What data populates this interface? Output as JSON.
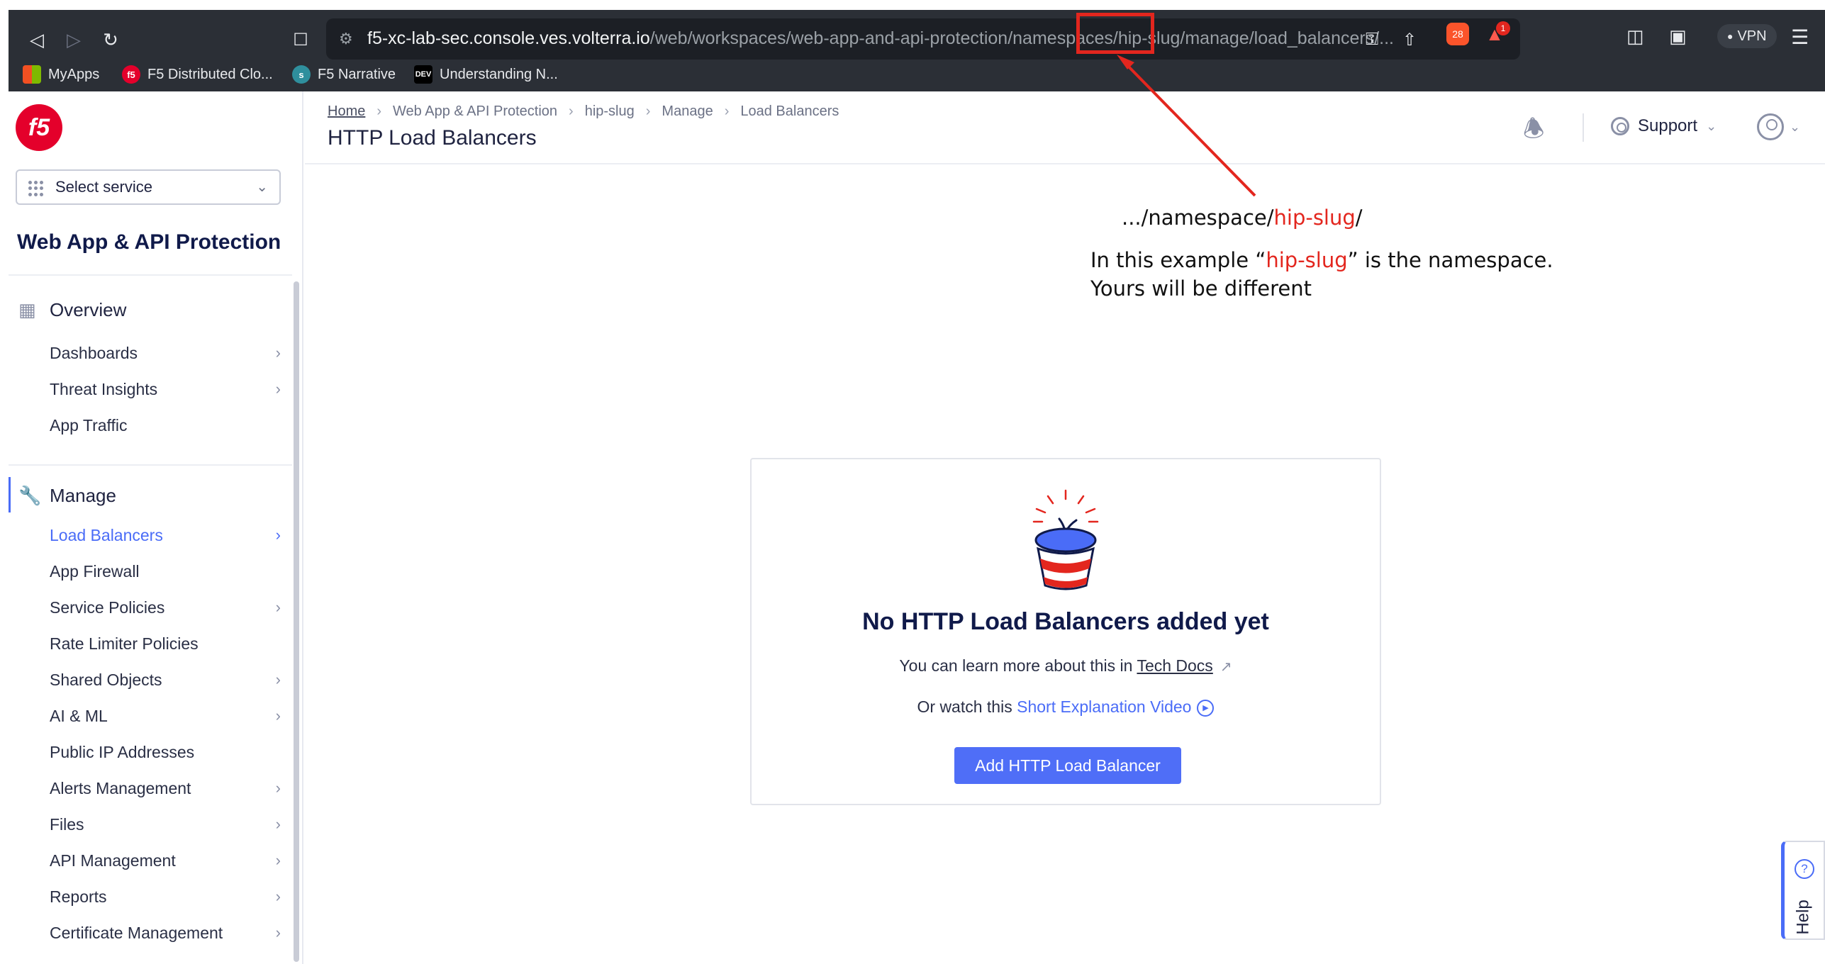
{
  "browser": {
    "url_host": "f5-xc-lab-sec.console.ves.volterra.io",
    "url_path": "/web/workspaces/web-app-and-api-protection/namespaces/hip-slug/manage/load_balancers/...",
    "extension_badge_count": "28",
    "alert_badge_count": "1",
    "vpn_label": "VPN",
    "bookmarks": [
      {
        "label": "MyApps"
      },
      {
        "label": "F5 Distributed Clo..."
      },
      {
        "label": "F5 Narrative"
      },
      {
        "label": "Understanding N..."
      }
    ]
  },
  "sidebar": {
    "logo_text": "f5",
    "service_select": "Select service",
    "workspace_title": "Web App & API Protection",
    "overview": {
      "label": "Overview",
      "items": [
        {
          "label": "Dashboards",
          "has_arrow": true
        },
        {
          "label": "Threat Insights",
          "has_arrow": true
        },
        {
          "label": "App Traffic",
          "has_arrow": false
        }
      ]
    },
    "manage": {
      "label": "Manage",
      "items": [
        {
          "label": "Load Balancers",
          "has_arrow": true,
          "active": true
        },
        {
          "label": "App Firewall",
          "has_arrow": false
        },
        {
          "label": "Service Policies",
          "has_arrow": true
        },
        {
          "label": "Rate Limiter Policies",
          "has_arrow": false
        },
        {
          "label": "Shared Objects",
          "has_arrow": true
        },
        {
          "label": "AI & ML",
          "has_arrow": true
        },
        {
          "label": "Public IP Addresses",
          "has_arrow": false
        },
        {
          "label": "Alerts Management",
          "has_arrow": true
        },
        {
          "label": "Files",
          "has_arrow": true
        },
        {
          "label": "API Management",
          "has_arrow": true
        },
        {
          "label": "Reports",
          "has_arrow": true
        },
        {
          "label": "Certificate Management",
          "has_arrow": true
        }
      ]
    }
  },
  "header": {
    "breadcrumbs": [
      "Home",
      "Web App & API Protection",
      "hip-slug",
      "Manage",
      "Load Balancers"
    ],
    "title": "HTTP Load Balancers",
    "support_label": "Support"
  },
  "annotation": {
    "path_prefix": ".../namespace/",
    "path_namespace": "hip-slug",
    "path_suffix": "/",
    "line1_prefix": "In this example “",
    "line1_namespace": "hip-slug",
    "line1_suffix": "” is the namespace.",
    "line2": "Yours will be different",
    "color": "#e3261e"
  },
  "empty_state": {
    "title": "No HTTP Load Balancers added yet",
    "learn_prefix": "You can learn more about this in ",
    "learn_link": "Tech Docs",
    "watch_prefix": "Or watch this ",
    "watch_link": "Short Explanation Video",
    "button_label": "Add HTTP Load Balancer"
  },
  "help": {
    "label": "Help"
  },
  "colors": {
    "accent": "#4a6cf7",
    "brand_red": "#e4002b",
    "chrome_bg": "#2b2f36"
  }
}
